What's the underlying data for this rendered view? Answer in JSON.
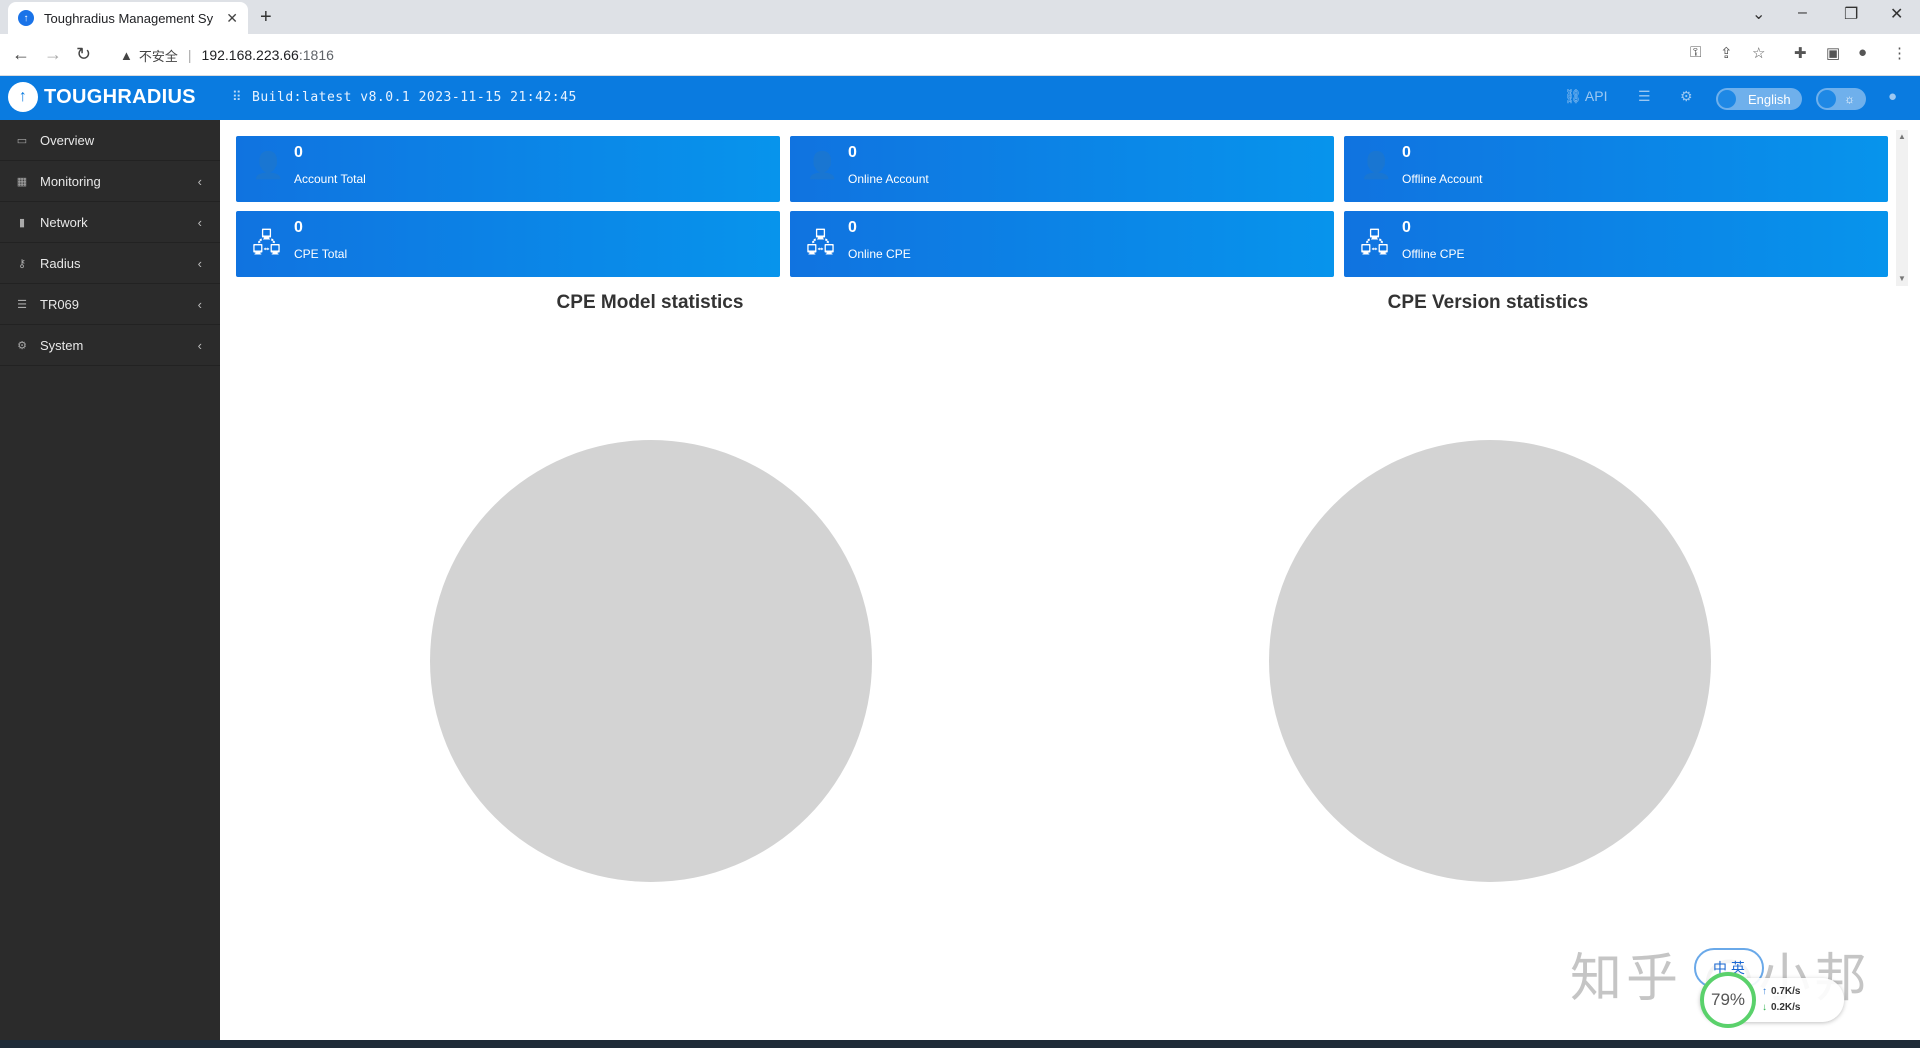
{
  "browser": {
    "tab_title": "Toughradius Management Sy",
    "tab_close": "✕",
    "new_tab": "+",
    "insecure_label": "不安全",
    "url_host": "192.168.223.66",
    "url_port": ":1816"
  },
  "header": {
    "logo": "TOUGHRADIUS",
    "build": "Build:latest v8.0.1 2023-11-15 21:42:45",
    "api_label": "API",
    "language": "English",
    "theme_symbol": "☼"
  },
  "sidebar": {
    "items": [
      {
        "label": "Overview"
      },
      {
        "label": "Monitoring"
      },
      {
        "label": "Network"
      },
      {
        "label": "Radius"
      },
      {
        "label": "TR069"
      },
      {
        "label": "System"
      }
    ]
  },
  "stats": {
    "account_total": {
      "value": "0",
      "label": "Account Total"
    },
    "online_account": {
      "value": "0",
      "label": "Online Account"
    },
    "offline_account": {
      "value": "0",
      "label": "Offline Account"
    },
    "cpe_total": {
      "value": "0",
      "label": "CPE Total"
    },
    "online_cpe": {
      "value": "0",
      "label": "Online CPE"
    },
    "offline_cpe": {
      "value": "0",
      "label": "Offline CPE"
    }
  },
  "charts": {
    "model_title": "CPE Model statistics",
    "version_title": "CPE Version statistics"
  },
  "overlay": {
    "watermark": "知乎 @小邦",
    "ime": "中 英",
    "cpu_percent": "79%",
    "up_rate": "0.7K/s",
    "down_rate": "0.2K/s"
  },
  "colors": {
    "header_blue": "#0a7be0",
    "sidebar_dark": "#2b2b2b",
    "card_blue": "#0794ec",
    "pie_grey": "#d3d3d3"
  }
}
